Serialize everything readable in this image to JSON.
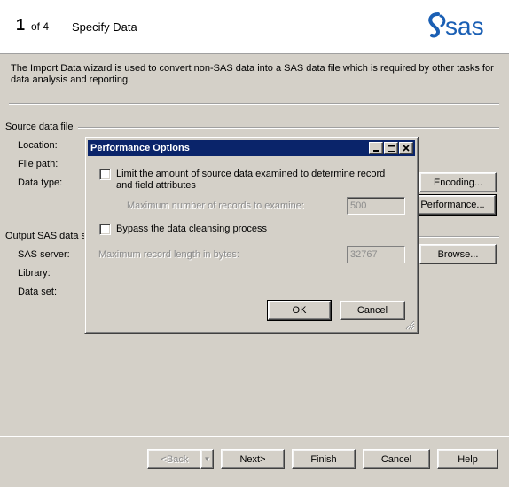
{
  "header": {
    "step_number": "1",
    "step_of": "of 4",
    "step_title": "Specify Data",
    "logo_text": "sas"
  },
  "description": "The Import Data wizard is used to convert non-SAS data into a SAS data file which is required by other tasks for data analysis and reporting.",
  "source_section": {
    "title": "Source data file",
    "location_label": "Location:",
    "file_path_label": "File path:",
    "data_type_label": "Data type:",
    "encoding_button": "Encoding...",
    "performance_button": "Performance..."
  },
  "output_section": {
    "title": "Output SAS data s",
    "sas_server_label": "SAS server:",
    "library_label": "Library:",
    "data_set_label": "Data set:",
    "browse_button": "Browse..."
  },
  "footer": {
    "back_button": "<Back",
    "next_button": "Next>",
    "finish_button": "Finish",
    "cancel_button": "Cancel",
    "help_button": "Help"
  },
  "dialog": {
    "title": "Performance Options",
    "limit_checkbox_label": "Limit the amount of source data examined to determine record and field attributes",
    "limit_checked": false,
    "max_records_label": "Maximum number of records to examine:",
    "max_records_value": "500",
    "bypass_checkbox_label": "Bypass the data cleansing process",
    "bypass_checked": false,
    "max_record_length_label": "Maximum record length in bytes:",
    "max_record_length_value": "32767",
    "ok_button": "OK",
    "cancel_button": "Cancel"
  },
  "colors": {
    "title_bar": "#0a246a",
    "logo_blue": "#1a5fb4",
    "background": "#d4d0c8"
  }
}
